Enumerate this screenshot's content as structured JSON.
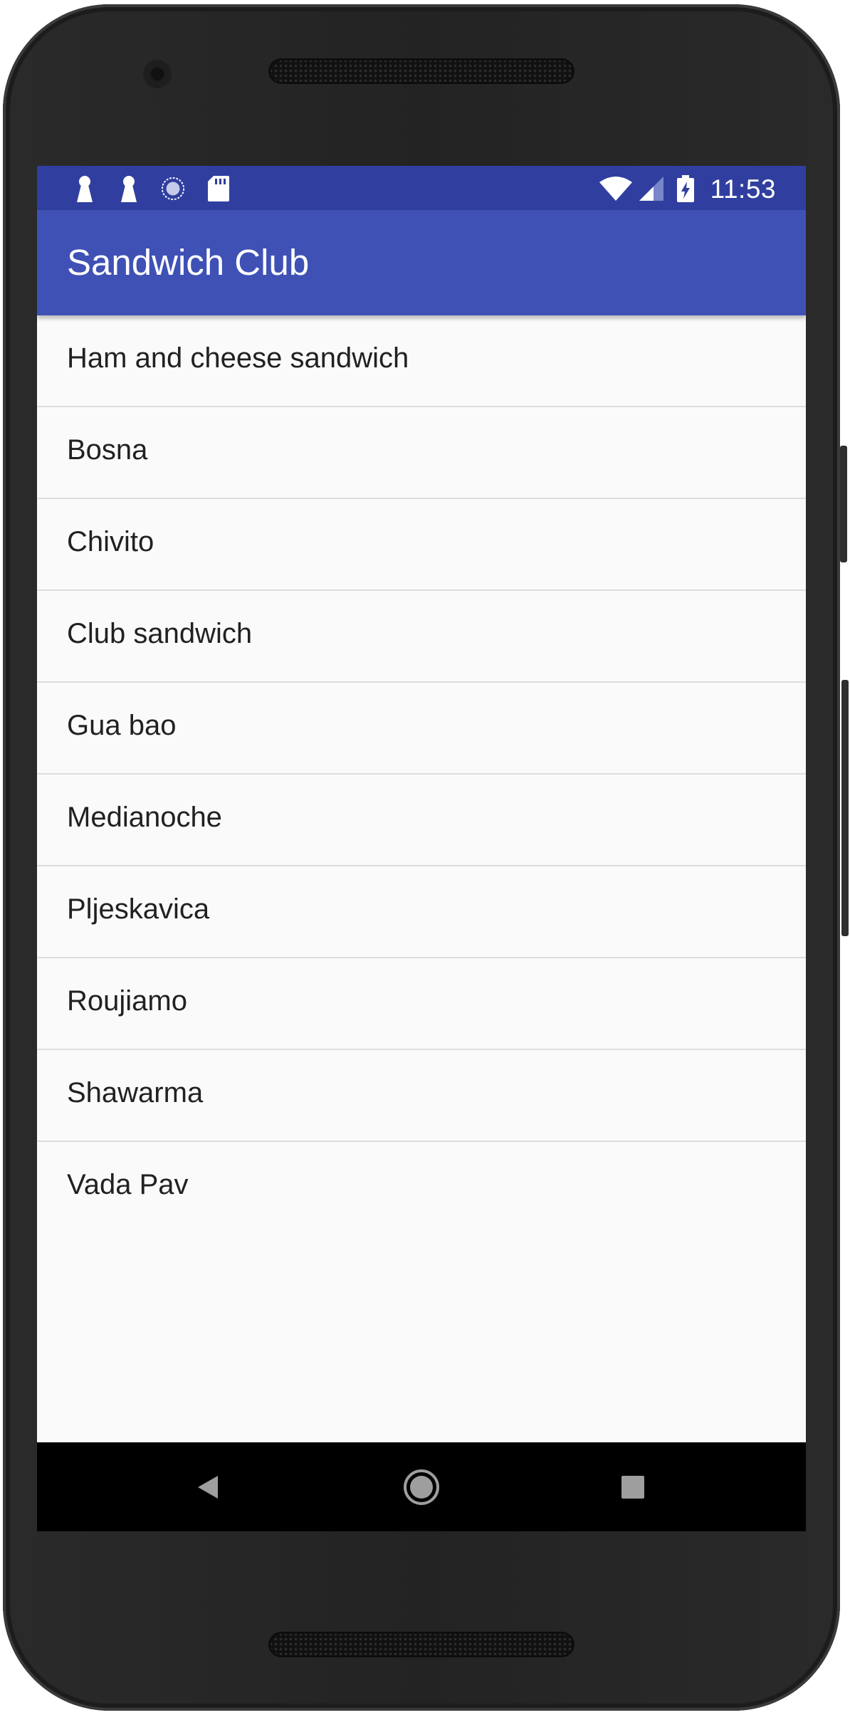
{
  "status_bar": {
    "time": "11:53",
    "left_icons": [
      "keyhole-icon",
      "keyhole-icon",
      "sync-icon",
      "sd-card-icon"
    ],
    "right_icons": [
      "wifi-icon",
      "signal-icon",
      "battery-charging-icon"
    ]
  },
  "app_bar": {
    "title": "Sandwich Club"
  },
  "list": {
    "items": [
      "Ham and cheese sandwich",
      "Bosna",
      "Chivito",
      "Club sandwich",
      "Gua bao",
      "Medianoche",
      "Pljeskavica",
      "Roujiamo",
      "Shawarma",
      "Vada Pav"
    ]
  },
  "nav_bar": {
    "buttons": [
      "back-icon",
      "home-icon",
      "recents-icon"
    ]
  },
  "colors": {
    "status_bar": "#303f9f",
    "app_bar": "#3f51b5",
    "background": "#fafafa",
    "divider": "#dddddd",
    "text": "#212121"
  }
}
